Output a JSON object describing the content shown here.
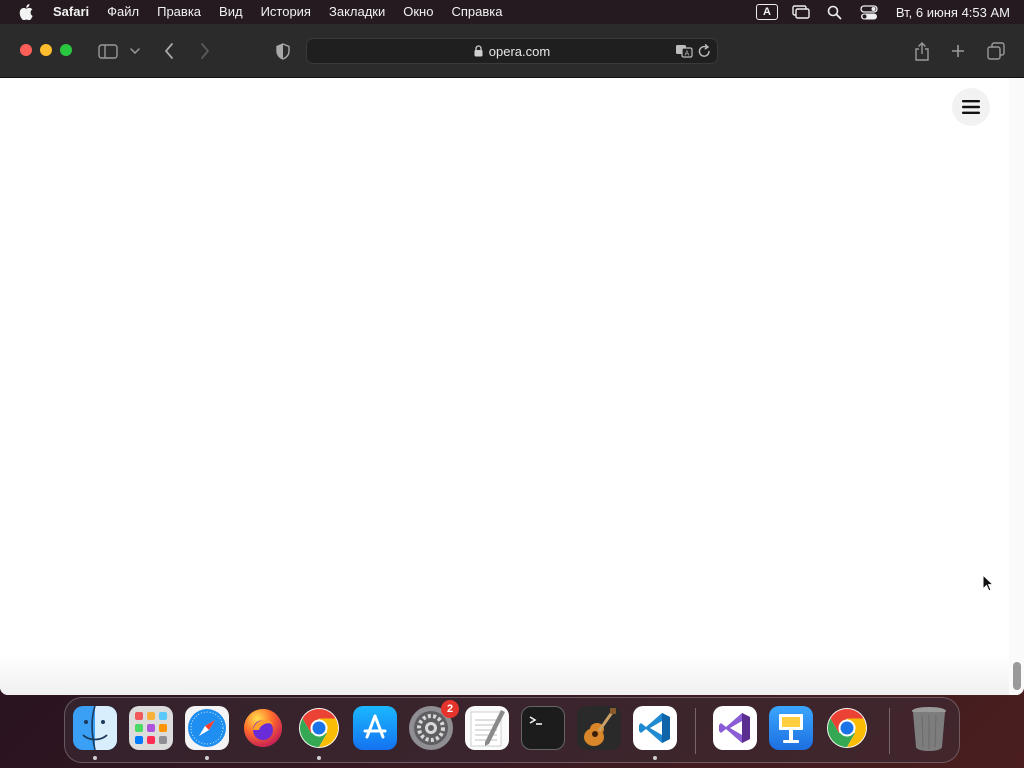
{
  "menubar": {
    "app_name": "Safari",
    "items": [
      "Файл",
      "Правка",
      "Вид",
      "История",
      "Закладки",
      "Окно",
      "Справка"
    ],
    "input_source": "A",
    "clock": "Вт, 6 июня  4:53 AM"
  },
  "browser": {
    "url": "opera.com"
  },
  "dock": {
    "apps": [
      {
        "name": "Finder",
        "icon": "finder-icon",
        "running": true
      },
      {
        "name": "Launchpad",
        "icon": "launchpad-icon",
        "running": false
      },
      {
        "name": "Safari",
        "icon": "safari-icon",
        "running": true
      },
      {
        "name": "Firefox",
        "icon": "firefox-icon",
        "running": false
      },
      {
        "name": "Google Chrome",
        "icon": "chrome-icon",
        "running": true
      },
      {
        "name": "App Store",
        "icon": "app-store-icon",
        "running": false
      },
      {
        "name": "System Settings",
        "icon": "system-settings-icon",
        "running": false,
        "badge": "2"
      },
      {
        "name": "TextEdit",
        "icon": "textedit-icon",
        "running": false
      },
      {
        "name": "Terminal",
        "icon": "terminal-icon",
        "running": false
      },
      {
        "name": "GarageBand",
        "icon": "garageband-icon",
        "running": false
      },
      {
        "name": "Visual Studio Code",
        "icon": "vscode-icon",
        "running": true
      },
      {
        "name": "Visual Studio",
        "icon": "visual-studio-icon",
        "running": false
      },
      {
        "name": "Keynote",
        "icon": "keynote-icon",
        "running": false
      },
      {
        "name": "Google Chrome",
        "icon": "chrome-icon",
        "running": false
      },
      {
        "name": "Trash",
        "icon": "trash-icon",
        "running": false
      }
    ]
  },
  "colors": {
    "close": "#ff5f57",
    "minimize": "#febc2e",
    "maximize": "#28c840",
    "badge": "#e5342c"
  }
}
